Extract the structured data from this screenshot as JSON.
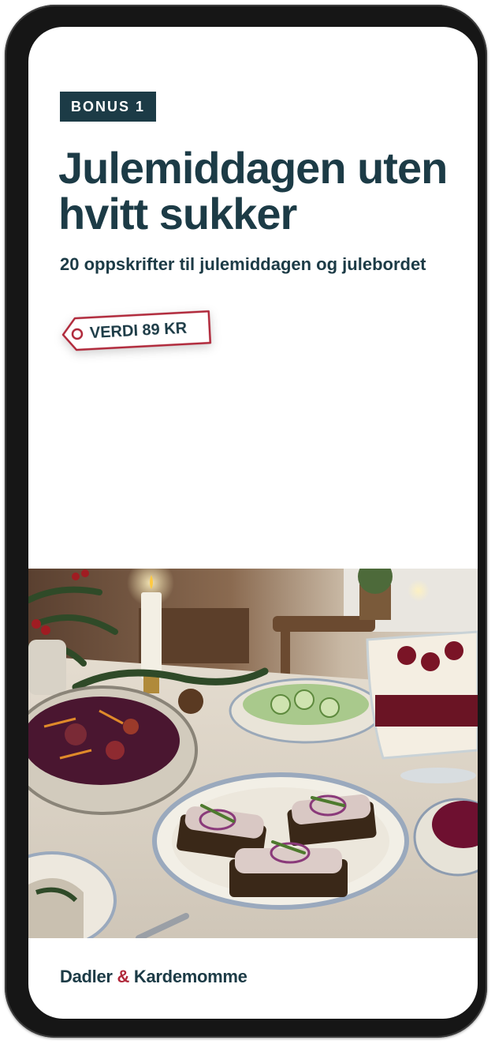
{
  "badge": {
    "label": "BONUS 1"
  },
  "hero": {
    "title": "Julemiddagen uten hvitt sukker",
    "subtitle": "20 oppskrifter til julemiddagen og julebordet"
  },
  "price_tag": {
    "label": "VERDI 89 KR",
    "icon": "tag-hole-icon"
  },
  "photo": {
    "subject": "christmas-dinner-table"
  },
  "brand": {
    "name_part1": "Dadler",
    "ampersand": "&",
    "name_part2": "Kardemomme"
  },
  "colors": {
    "primary": "#1c3b46",
    "accent": "#b0283a",
    "background": "#ffffff",
    "frame": "#161616"
  }
}
